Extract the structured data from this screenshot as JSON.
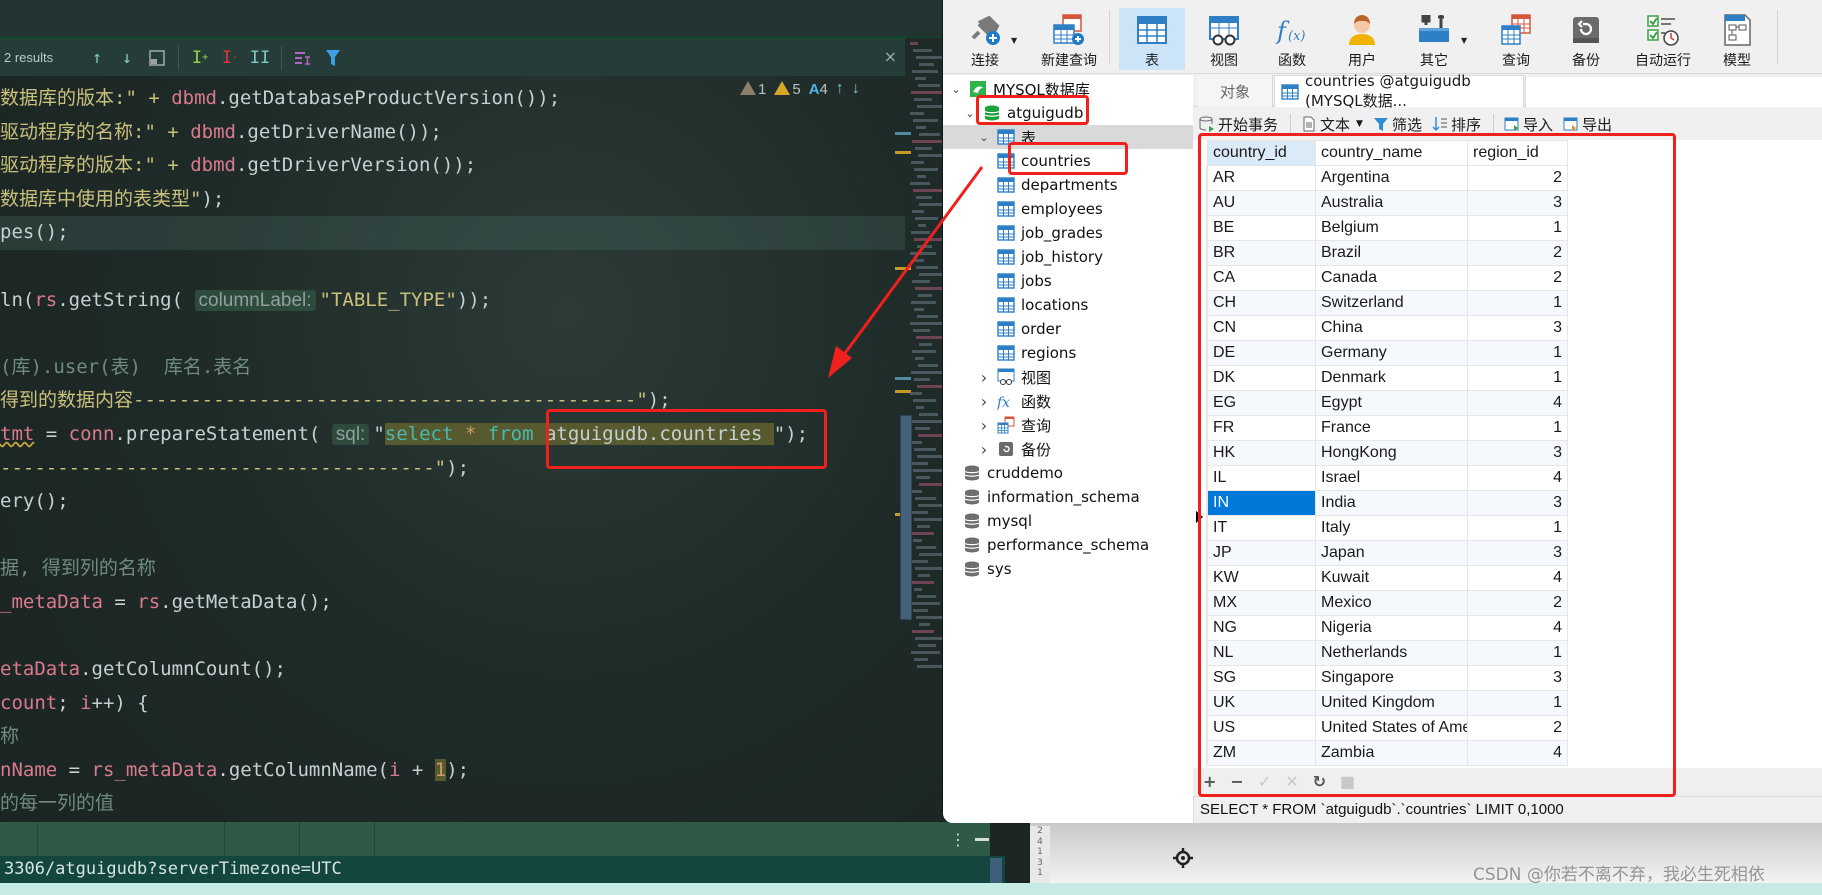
{
  "editor": {
    "find": {
      "results": "2 results",
      "icons": [
        "arrow-up-icon",
        "arrow-down-icon",
        "select-all-occurrences-icon",
        "add-selection-icon",
        "remove-selection-icon",
        "toggle-selection-icon",
        "filter-lines-icon",
        "filter-icon"
      ],
      "close": "×"
    },
    "inspections": {
      "weak_warnings": "1",
      "warnings": "5",
      "typos": "4"
    },
    "lines": [
      {
        "p": [
          [
            "s",
            "数据库的版本:\" + "
          ],
          [
            "v",
            "dbmd"
          ],
          [
            "t",
            ".getDatabaseProductVersion());"
          ]
        ]
      },
      {
        "p": [
          [
            "s",
            "驱动程序的名称:\" + "
          ],
          [
            "v",
            "dbmd"
          ],
          [
            "t",
            ".getDriverName());"
          ]
        ]
      },
      {
        "p": [
          [
            "s",
            "驱动程序的版本:\" + "
          ],
          [
            "v",
            "dbmd"
          ],
          [
            "t",
            ".getDriverVersion());"
          ]
        ]
      },
      {
        "p": [
          [
            "s",
            "数据库中使用的表类型\""
          ],
          [
            "t",
            ");"
          ]
        ]
      },
      {
        "p": [
          [
            "t",
            "pes();"
          ]
        ],
        "hl": true
      },
      {
        "p": []
      },
      {
        "p": [
          [
            "t",
            "ln("
          ],
          [
            "v",
            "rs"
          ],
          [
            "t",
            ".getString( "
          ],
          [
            "h",
            "columnLabel:"
          ],
          [
            "s",
            "\"TABLE_TYPE\""
          ],
          [
            "t",
            "));"
          ]
        ]
      },
      {
        "p": []
      },
      {
        "p": [
          [
            "c",
            "(库).user(表)  库名.表名"
          ]
        ]
      },
      {
        "p": [
          [
            "s",
            "得到的数据内容--------------------------------------------\""
          ],
          [
            "t",
            ");"
          ]
        ]
      },
      {
        "p": [
          [
            "w",
            "tmt"
          ],
          [
            "t",
            " = "
          ],
          [
            "v",
            "conn"
          ],
          [
            "t",
            ".prepareStatement( "
          ],
          [
            "h",
            "sql:"
          ],
          [
            "t",
            "\""
          ],
          [
            "k",
            "select "
          ],
          [
            "n",
            "* "
          ],
          [
            "k",
            "from "
          ],
          [
            "q",
            "atguigudb.countries "
          ],
          [
            "t",
            "\");"
          ]
        ]
      },
      {
        "p": [
          [
            "s",
            "--------------------------------------\""
          ],
          [
            "t",
            ");"
          ]
        ]
      },
      {
        "p": [
          [
            "t",
            "ery();"
          ]
        ]
      },
      {
        "p": []
      },
      {
        "p": [
          [
            "c",
            "据, 得到列的名称"
          ]
        ]
      },
      {
        "p": [
          [
            "v",
            "_metaData"
          ],
          [
            "t",
            " = "
          ],
          [
            "v",
            "rs"
          ],
          [
            "t",
            ".getMetaData();"
          ]
        ]
      },
      {
        "p": []
      },
      {
        "p": [
          [
            "v",
            "etaData"
          ],
          [
            "t",
            ".getColumnCount();"
          ]
        ]
      },
      {
        "p": [
          [
            "v",
            "count"
          ],
          [
            "t",
            "; "
          ],
          [
            "v",
            "i"
          ],
          [
            "t",
            "++) {"
          ]
        ]
      },
      {
        "p": [
          [
            "c",
            "称"
          ]
        ]
      },
      {
        "p": [
          [
            "v",
            "nName"
          ],
          [
            "t",
            " = "
          ],
          [
            "v",
            "rs_metaData"
          ],
          [
            "t",
            ".getColumnName("
          ],
          [
            "v",
            "i"
          ],
          [
            "t",
            " + "
          ],
          [
            "n",
            "1"
          ],
          [
            "t",
            ");"
          ]
        ]
      },
      {
        "p": [
          [
            "c",
            "的每一列的值"
          ]
        ]
      }
    ],
    "console_text": "3306/atguigudb?serverTimezone=UTC",
    "run_menu_icon": "⋮"
  },
  "navicat": {
    "toolbar": [
      {
        "label": "连接",
        "icon": "connection-icon",
        "caret": true
      },
      {
        "label": "新建查询",
        "icon": "new-query-icon"
      },
      {
        "label": "表",
        "icon": "table-icon",
        "active": true
      },
      {
        "label": "视图",
        "icon": "view-icon"
      },
      {
        "label": "函数",
        "icon": "function-icon"
      },
      {
        "label": "用户",
        "icon": "user-icon"
      },
      {
        "label": "其它",
        "icon": "tools-icon",
        "caret": true
      },
      {
        "label": "查询",
        "icon": "query-icon"
      },
      {
        "label": "备份",
        "icon": "backup-icon"
      },
      {
        "label": "自动运行",
        "icon": "automation-icon"
      },
      {
        "label": "模型",
        "icon": "model-icon"
      }
    ],
    "tree": {
      "connection": "MYSQL数据库",
      "database": "atguigudb",
      "tables_folder": "表",
      "tables": [
        "countries",
        "departments",
        "employees",
        "job_grades",
        "job_history",
        "jobs",
        "locations",
        "order",
        "regions"
      ],
      "folders": [
        {
          "label": "视图",
          "icon": "view-icon"
        },
        {
          "label": "函数",
          "icon": "function-icon"
        },
        {
          "label": "查询",
          "icon": "query-icon"
        },
        {
          "label": "备份",
          "icon": "backup-icon"
        }
      ],
      "other_databases": [
        "cruddemo",
        "information_schema",
        "mysql",
        "performance_schema",
        "sys"
      ]
    },
    "tabs": {
      "objects": "对象",
      "current": "countries @atguigudb (MYSQL数据..."
    },
    "object_toolbar": {
      "begin_transaction": "开始事务",
      "text": "文本",
      "filter": "筛选",
      "sort": "排序",
      "import": "导入",
      "export": "导出"
    },
    "grid": {
      "columns": [
        "country_id",
        "country_name",
        "region_id"
      ],
      "rows": [
        [
          "AR",
          "Argentina",
          "2"
        ],
        [
          "AU",
          "Australia",
          "3"
        ],
        [
          "BE",
          "Belgium",
          "1"
        ],
        [
          "BR",
          "Brazil",
          "2"
        ],
        [
          "CA",
          "Canada",
          "2"
        ],
        [
          "CH",
          "Switzerland",
          "1"
        ],
        [
          "CN",
          "China",
          "3"
        ],
        [
          "DE",
          "Germany",
          "1"
        ],
        [
          "DK",
          "Denmark",
          "1"
        ],
        [
          "EG",
          "Egypt",
          "4"
        ],
        [
          "FR",
          "France",
          "1"
        ],
        [
          "HK",
          "HongKong",
          "3"
        ],
        [
          "IL",
          "Israel",
          "4"
        ],
        [
          "IN",
          "India",
          "3"
        ],
        [
          "IT",
          "Italy",
          "1"
        ],
        [
          "JP",
          "Japan",
          "3"
        ],
        [
          "KW",
          "Kuwait",
          "4"
        ],
        [
          "MX",
          "Mexico",
          "2"
        ],
        [
          "NG",
          "Nigeria",
          "4"
        ],
        [
          "NL",
          "Netherlands",
          "1"
        ],
        [
          "SG",
          "Singapore",
          "3"
        ],
        [
          "UK",
          "United Kingdom",
          "1"
        ],
        [
          "US",
          "United States of Ame",
          "2"
        ],
        [
          "ZM",
          "Zambia",
          "4"
        ]
      ],
      "selected_row": 13,
      "footer_icons": [
        "+",
        "−",
        "✓",
        "✕",
        "↻",
        "■"
      ]
    },
    "status_sql": "SELECT * FROM `atguigudb`.`countries` LIMIT 0,1000"
  },
  "background_numbers": [
    "2",
    "4",
    "1",
    "3",
    "1"
  ],
  "watermark": "CSDN @你若不离不弃，我必生死相依",
  "colors": {
    "annotation_red": "#f0201c",
    "selection_blue": "#0078d7",
    "toolbar_active": "#cce4f7"
  }
}
